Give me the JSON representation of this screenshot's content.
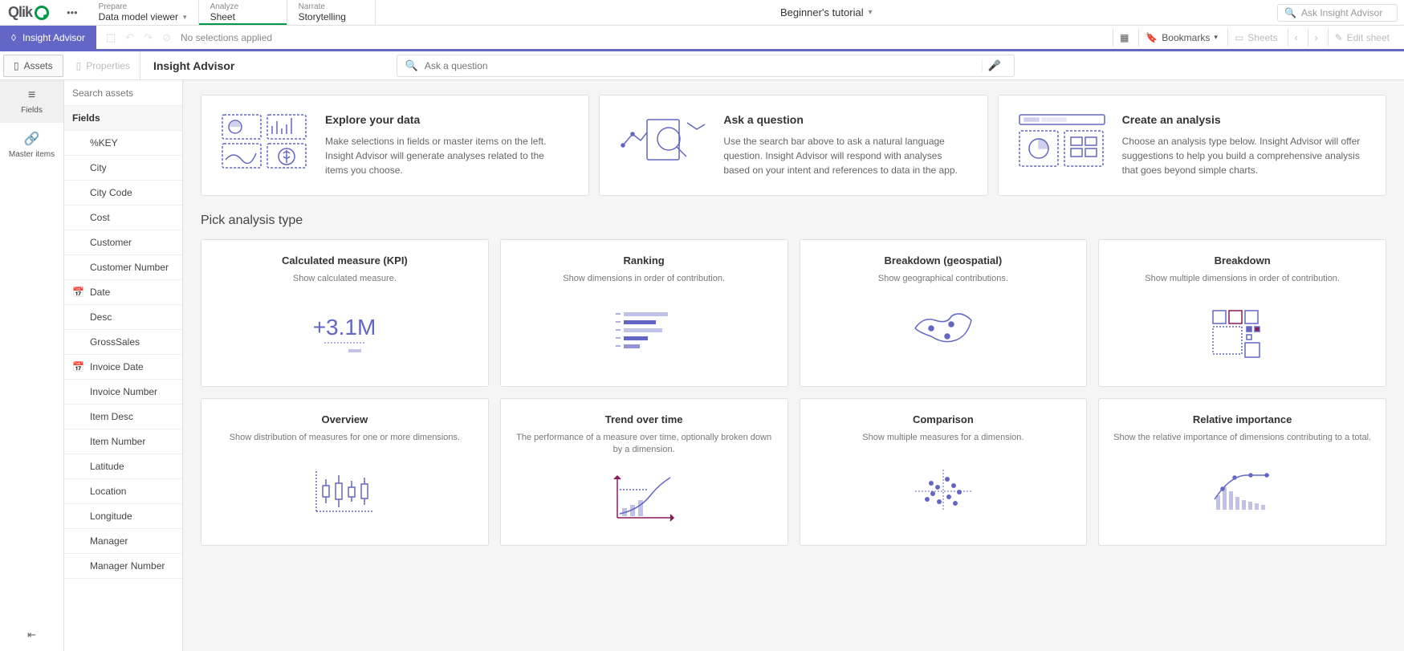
{
  "nav": {
    "prepare_top": "Prepare",
    "prepare_bottom": "Data model viewer",
    "analyze_top": "Analyze",
    "analyze_bottom": "Sheet",
    "narrate_top": "Narrate",
    "narrate_bottom": "Storytelling"
  },
  "app_title": "Beginner's tutorial",
  "top_search_placeholder": "Ask Insight Advisor",
  "insight_advisor_btn": "Insight Advisor",
  "no_selections": "No selections applied",
  "bookmarks_label": "Bookmarks",
  "sheets_label": "Sheets",
  "edit_sheet_label": "Edit sheet",
  "assets_label": "Assets",
  "properties_label": "Properties",
  "main_heading": "Insight Advisor",
  "ask_placeholder": "Ask a question",
  "rail": {
    "fields": "Fields",
    "master": "Master items"
  },
  "search_assets_placeholder": "Search assets",
  "fields_header": "Fields",
  "fields": [
    {
      "label": "%KEY",
      "icon": ""
    },
    {
      "label": "City",
      "icon": ""
    },
    {
      "label": "City Code",
      "icon": ""
    },
    {
      "label": "Cost",
      "icon": ""
    },
    {
      "label": "Customer",
      "icon": ""
    },
    {
      "label": "Customer Number",
      "icon": ""
    },
    {
      "label": "Date",
      "icon": "cal"
    },
    {
      "label": "Desc",
      "icon": ""
    },
    {
      "label": "GrossSales",
      "icon": ""
    },
    {
      "label": "Invoice Date",
      "icon": "cal"
    },
    {
      "label": "Invoice Number",
      "icon": ""
    },
    {
      "label": "Item Desc",
      "icon": ""
    },
    {
      "label": "Item Number",
      "icon": ""
    },
    {
      "label": "Latitude",
      "icon": ""
    },
    {
      "label": "Location",
      "icon": ""
    },
    {
      "label": "Longitude",
      "icon": ""
    },
    {
      "label": "Manager",
      "icon": ""
    },
    {
      "label": "Manager Number",
      "icon": ""
    }
  ],
  "intro": [
    {
      "title": "Explore your data",
      "body": "Make selections in fields or master items on the left. Insight Advisor will generate analyses related to the items you choose."
    },
    {
      "title": "Ask a question",
      "body": "Use the search bar above to ask a natural language question. Insight Advisor will respond with analyses based on your intent and references to data in the app."
    },
    {
      "title": "Create an analysis",
      "body": "Choose an analysis type below. Insight Advisor will offer suggestions to help you build a comprehensive analysis that goes beyond simple charts."
    }
  ],
  "pick_title": "Pick analysis type",
  "atypes": [
    {
      "title": "Calculated measure (KPI)",
      "desc": "Show calculated measure."
    },
    {
      "title": "Ranking",
      "desc": "Show dimensions in order of contribution."
    },
    {
      "title": "Breakdown (geospatial)",
      "desc": "Show geographical contributions."
    },
    {
      "title": "Breakdown",
      "desc": "Show multiple dimensions in order of contribution."
    },
    {
      "title": "Overview",
      "desc": "Show distribution of measures for one or more dimensions."
    },
    {
      "title": "Trend over time",
      "desc": "The performance of a measure over time, optionally broken down by a dimension."
    },
    {
      "title": "Comparison",
      "desc": "Show multiple measures for a dimension."
    },
    {
      "title": "Relative importance",
      "desc": "Show the relative importance of dimensions contributing to a total."
    }
  ]
}
